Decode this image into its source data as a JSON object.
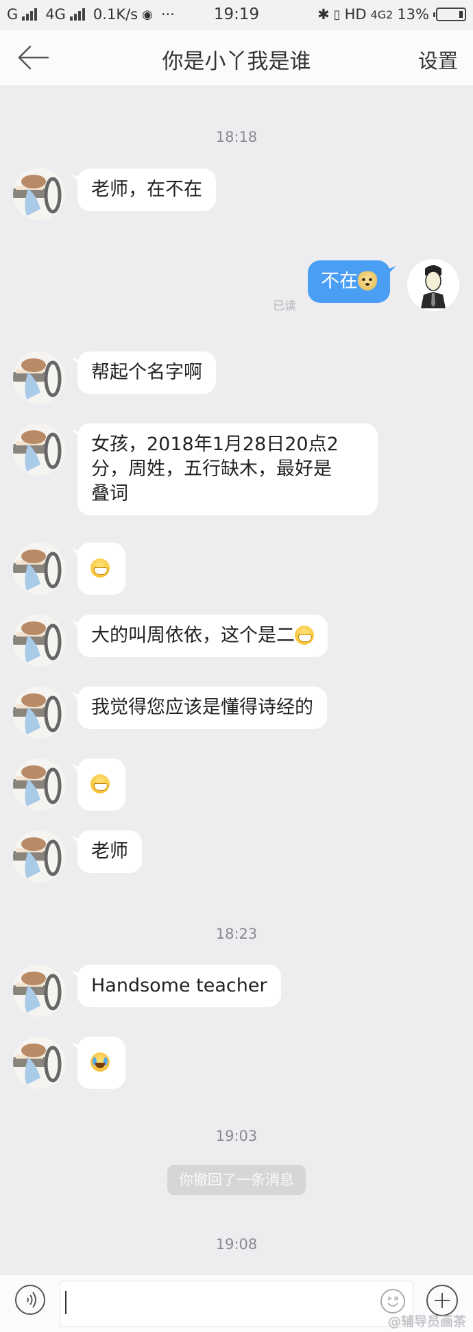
{
  "status_bar": {
    "carrier1": "G",
    "carrier2": "4G",
    "net_speed": "0.1K/s",
    "weibo_icon": "weibo-icon",
    "more": "···",
    "time": "19:19",
    "hd": "HD",
    "net_type": "4G2",
    "battery_percent": "13%",
    "battery_level": 0.13
  },
  "nav": {
    "back_icon": "back-arrow-icon",
    "title": "你是小丫我是谁",
    "settings_label": "设置"
  },
  "colors": {
    "my_bubble": "#4a9ff5",
    "other_bubble": "#ffffff",
    "chat_background": "#ededf0"
  },
  "timestamps": [
    "18:18",
    "18:23",
    "19:03",
    "19:08"
  ],
  "messages": [
    {
      "side": "left",
      "text": "老师，在不在"
    },
    {
      "side": "right",
      "text": "不在",
      "emoji": "doge-emoji",
      "read_status": "已读"
    },
    {
      "side": "left",
      "text": "帮起个名字啊"
    },
    {
      "side": "left",
      "lines": [
        "女孩，2018年1月28日20点2",
        "分，周姓，五行缺木，最好是",
        "叠词"
      ]
    },
    {
      "side": "left",
      "text": "",
      "emoji": "grin-emoji"
    },
    {
      "side": "left",
      "text": "大的叫周依依，这个是二",
      "emoji": "grin-emoji"
    },
    {
      "side": "left",
      "text": "我觉得您应该是懂得诗经的"
    },
    {
      "side": "left",
      "text": "",
      "emoji": "grin-emoji"
    },
    {
      "side": "left",
      "text": "老师"
    },
    {
      "side": "left",
      "text": "Handsome teacher"
    },
    {
      "side": "left",
      "text": "",
      "emoji": "laugh-cry-emoji"
    }
  ],
  "system_notice": "你撤回了一条消息",
  "input_bar": {
    "voice_icon": "voice-icon",
    "input_value": "",
    "emoji_icon": "smiley-icon",
    "plus_icon": "plus-icon"
  },
  "watermark": "@辅导员画茶"
}
